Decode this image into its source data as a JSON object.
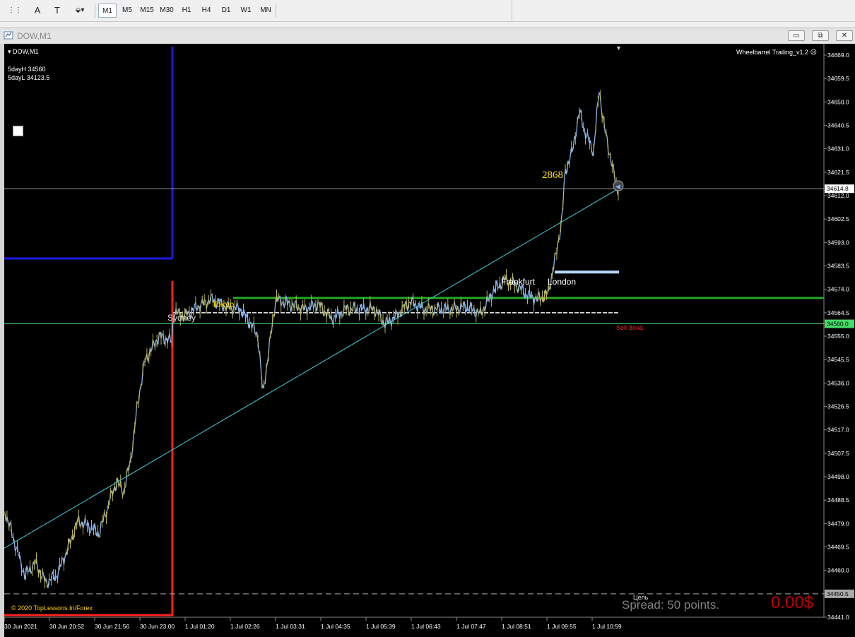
{
  "toolbar": {
    "timeframes": [
      "M1",
      "M5",
      "M15",
      "M30",
      "H1",
      "H4",
      "D1",
      "W1",
      "MN"
    ],
    "active": "M1",
    "tools": [
      {
        "name": "crosshair-tool-icon",
        "glyph": "⋮⋮"
      },
      {
        "name": "text-tool-icon",
        "glyph": "A"
      },
      {
        "name": "text-label-tool-icon",
        "glyph": "T"
      },
      {
        "name": "shapes-tool-icon",
        "glyph": "⬙▾"
      }
    ]
  },
  "window": {
    "title": "DOW,M1",
    "minimize": "▭",
    "maximize": "⧉",
    "close": "✕"
  },
  "chart": {
    "symbol_label": "DOW,M1",
    "day_high": "5dayH 34560",
    "day_low": "5dayL 34123.5",
    "indicator": "Wheelbarrel Trailing_v1.2",
    "copyright": "© 2020 TopLessons.In/Forex",
    "big_number": "2868",
    "sessions": {
      "sydney": "Sydney",
      "tokyo": "Tokyo",
      "frankfurt": "Frankfurt",
      "london": "London"
    },
    "sell_zone": "Sell Зона",
    "target": "Цель",
    "spread": "Spread: 50 points.",
    "pnl": "0.00$",
    "price_axis": [
      "34669.0",
      "34659.5",
      "34650.0",
      "34640.5",
      "34631.0",
      "34621.5",
      "34612.0",
      "34602.5",
      "34593.0",
      "34583.5",
      "34574.0",
      "34564.5",
      "34555.0",
      "34545.5",
      "34536.0",
      "34526.5",
      "34517.0",
      "34507.5",
      "34498.0",
      "34488.5",
      "34479.0",
      "34469.5",
      "34460.0",
      "34450.5",
      "34441.0"
    ],
    "current_price": "34614.8",
    "sell_price": "34560.0",
    "target_price": "34450.5",
    "time_axis": [
      "30 Jun 2021",
      "30 Jun 20:52",
      "30 Jun 21:56",
      "30 Jun 23:00",
      "1 Jul 01:20",
      "1 Jul 02:26",
      "1 Jul 03:31",
      "1 Jul 04:35",
      "1 Jul 05:39",
      "1 Jul 06:43",
      "1 Jul 07:47",
      "1 Jul 08:51",
      "1 Jul 09:55",
      "1 Jul 10:59"
    ]
  },
  "colors": {
    "background": "#000000",
    "candles_up": "#8db4e2",
    "candles_down": "#b8b25a",
    "trend_line": "#40d0e0",
    "blue_box": "#1a1ae0",
    "red_box": "#ff2020",
    "green_line": "#22aa22",
    "sell_line": "#44dd66",
    "text_yellow": "#ffe000",
    "pnl_red": "#c00000"
  }
}
